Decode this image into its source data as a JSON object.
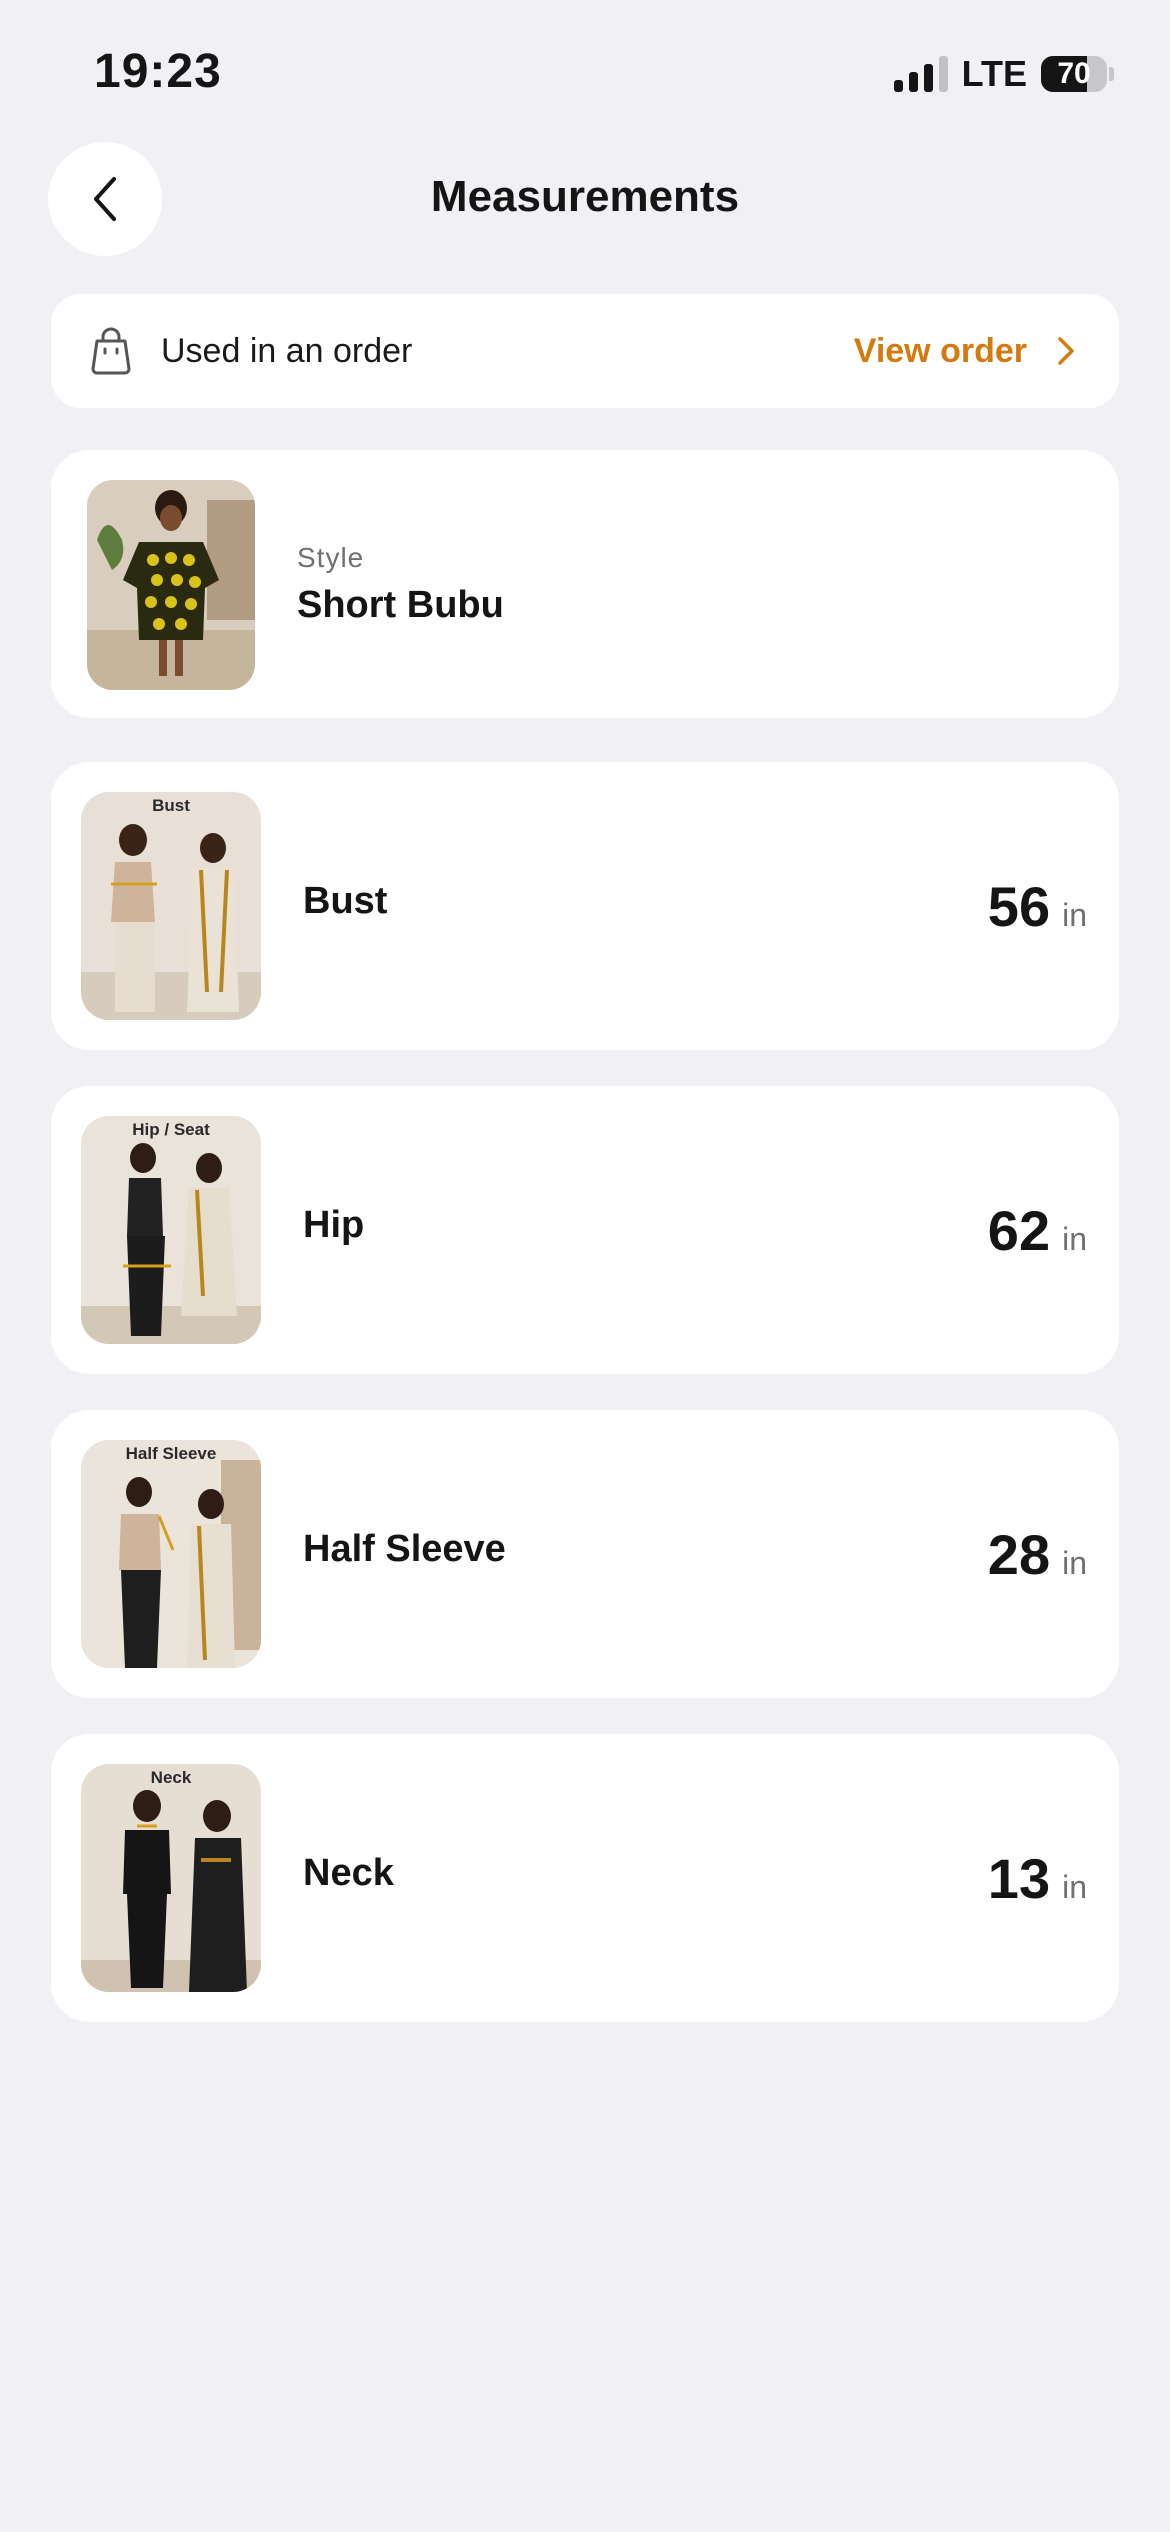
{
  "status_bar": {
    "time": "19:23",
    "network": "LTE",
    "battery": "70",
    "battery_level": 0.7,
    "signal_bars": 3
  },
  "header": {
    "title": "Measurements"
  },
  "order_banner": {
    "text": "Used in an order",
    "link_label": "View order",
    "accent_color": "#d47a0e"
  },
  "style": {
    "label": "Style",
    "name": "Short Bubu"
  },
  "measurements": [
    {
      "name": "Bust",
      "value": "56",
      "unit": "in",
      "image_caption": "Bust"
    },
    {
      "name": "Hip",
      "value": "62",
      "unit": "in",
      "image_caption": "Hip / Seat"
    },
    {
      "name": "Half Sleeve",
      "value": "28",
      "unit": "in",
      "image_caption": "Half Sleeve"
    },
    {
      "name": "Neck",
      "value": "13",
      "unit": "in",
      "image_caption": "Neck"
    }
  ]
}
